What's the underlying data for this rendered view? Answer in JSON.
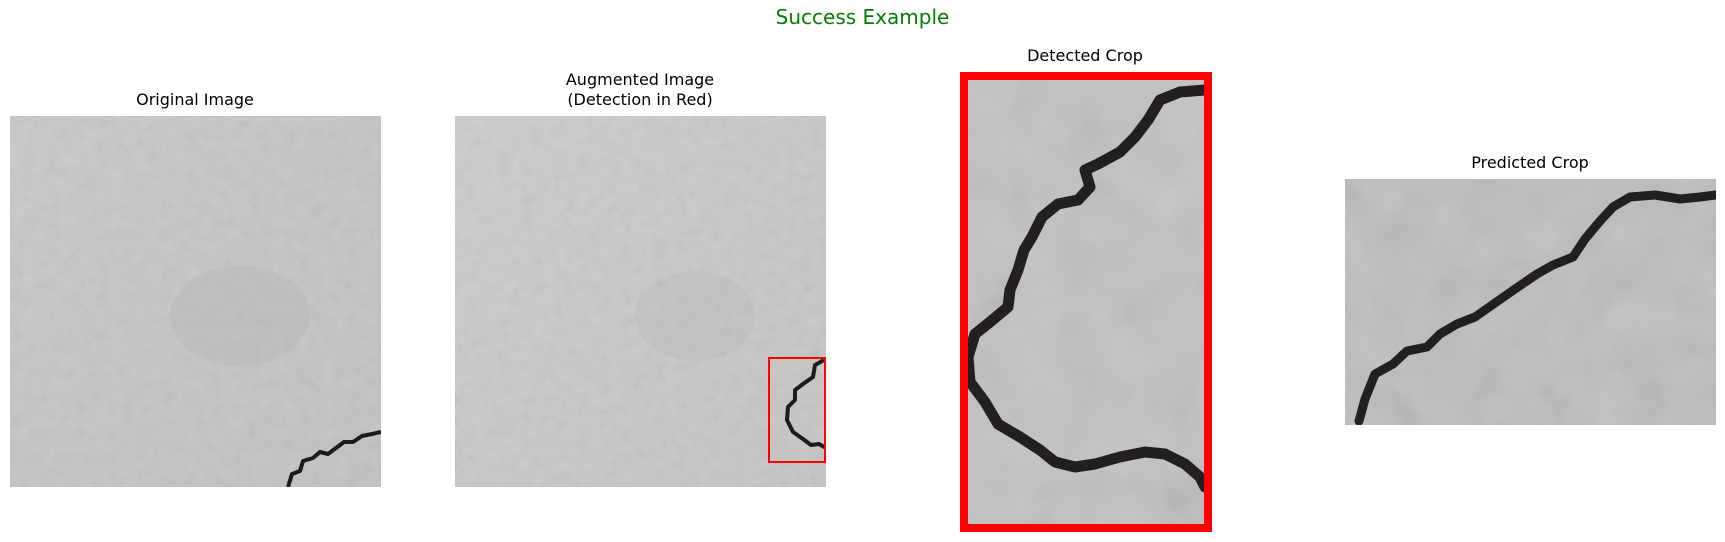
{
  "figure": {
    "title": "Success Example",
    "title_color": "#008000",
    "crack_color": "#1e1a1c",
    "concrete_color": "#c6c6c5",
    "highlight_color": "#ff0000"
  },
  "panels": [
    {
      "title": "Original Image"
    },
    {
      "title": "Augmented Image\n(Detection in Red)"
    },
    {
      "title": "Detected Crop"
    },
    {
      "title": "Predicted Crop"
    }
  ]
}
